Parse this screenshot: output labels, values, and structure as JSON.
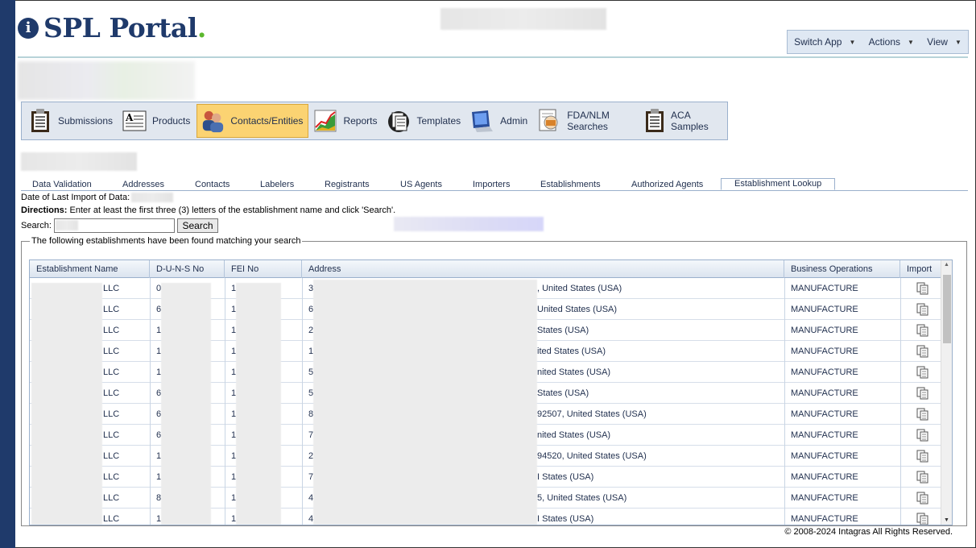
{
  "header": {
    "logo_text": "SPL Portal",
    "logo_dot": ".",
    "logo_icon_glyph": "i",
    "menu": [
      {
        "label": "Switch App"
      },
      {
        "label": "Actions"
      },
      {
        "label": "View"
      }
    ]
  },
  "nav": [
    {
      "label": "Submissions",
      "icon": "clipboard-icon",
      "active": false
    },
    {
      "label": "Products",
      "icon": "document-a-icon",
      "active": false
    },
    {
      "label": "Contacts/Entities",
      "icon": "people-icon",
      "active": true
    },
    {
      "label": "Reports",
      "icon": "chart-icon",
      "active": false
    },
    {
      "label": "Templates",
      "icon": "pages-icon",
      "active": false
    },
    {
      "label": "Admin",
      "icon": "monitor-icon",
      "active": false
    },
    {
      "label": "FDA/NLM Searches",
      "icon": "search-doc-icon",
      "active": false
    },
    {
      "label": "ACA Samples",
      "icon": "clipboard-icon",
      "active": false
    }
  ],
  "tabs": [
    {
      "label": "Data Validation",
      "active": false
    },
    {
      "label": "Addresses",
      "active": false
    },
    {
      "label": "Contacts",
      "active": false
    },
    {
      "label": "Labelers",
      "active": false
    },
    {
      "label": "Registrants",
      "active": false
    },
    {
      "label": "US Agents",
      "active": false
    },
    {
      "label": "Importers",
      "active": false
    },
    {
      "label": "Establishments",
      "active": false
    },
    {
      "label": "Authorized Agents",
      "active": false
    },
    {
      "label": "Establishment Lookup",
      "active": true
    }
  ],
  "lookup": {
    "last_import_label": "Date of Last Import of Data:",
    "directions_label": "Directions:",
    "directions_text": " Enter at least the first three (3) letters of the establishment name and click 'Search'.",
    "search_label": "Search:",
    "search_button": "Search",
    "results_legend": "The following establishments have been found matching your search"
  },
  "grid": {
    "columns": [
      "Establishment Name",
      "D-U-N-S No",
      "FEI No",
      "Address",
      "Business Operations",
      "Import"
    ],
    "rows": [
      {
        "name": "LLC",
        "duns": "0",
        "fei": "1",
        "addr_start": "3",
        "addr_end": ", United States (USA)",
        "ops": "MANUFACTURE"
      },
      {
        "name": "LLC",
        "duns": "6",
        "fei": "1",
        "addr_start": "6",
        "addr_end": "United States (USA)",
        "ops": "MANUFACTURE"
      },
      {
        "name": "LLC",
        "duns": "1",
        "fei": "1",
        "addr_start": "2",
        "addr_end": "States (USA)",
        "ops": "MANUFACTURE"
      },
      {
        "name": "LLC",
        "duns": "1",
        "fei": "1",
        "addr_start": "1",
        "addr_end": "ited States (USA)",
        "ops": "MANUFACTURE"
      },
      {
        "name": "LLC",
        "duns": "1",
        "fei": "1",
        "addr_start": "5",
        "addr_end": "nited States (USA)",
        "ops": "MANUFACTURE"
      },
      {
        "name": "LLC",
        "duns": "6",
        "fei": "1",
        "addr_start": "5",
        "addr_end": "States (USA)",
        "ops": "MANUFACTURE"
      },
      {
        "name": "LLC",
        "duns": "6",
        "fei": "1",
        "addr_start": "8",
        "addr_end": "92507, United States (USA)",
        "ops": "MANUFACTURE"
      },
      {
        "name": "LLC",
        "duns": "6",
        "fei": "1",
        "addr_start": "7",
        "addr_end": "nited States (USA)",
        "ops": "MANUFACTURE"
      },
      {
        "name": "LLC",
        "duns": "1",
        "fei": "1",
        "addr_start": "2",
        "addr_end": "94520, United States (USA)",
        "ops": "MANUFACTURE"
      },
      {
        "name": "LLC",
        "duns": "1",
        "fei": "1",
        "addr_start": "7",
        "addr_end": "I States (USA)",
        "ops": "MANUFACTURE"
      },
      {
        "name": "LLC",
        "duns": "8",
        "fei": "1",
        "addr_start": "4",
        "addr_end": "5, United States (USA)",
        "ops": "MANUFACTURE"
      },
      {
        "name": "LLC",
        "duns": "1",
        "fei": "1",
        "addr_start": "4",
        "addr_end": "I States (USA)",
        "ops": "MANUFACTURE"
      }
    ]
  },
  "footer": {
    "copyright": "© 2008-2024 Intagras All Rights Reserved."
  },
  "colors": {
    "brand_navy": "#1f3a6b",
    "brand_green": "#5cb82e",
    "active_tab": "#fbd372"
  }
}
